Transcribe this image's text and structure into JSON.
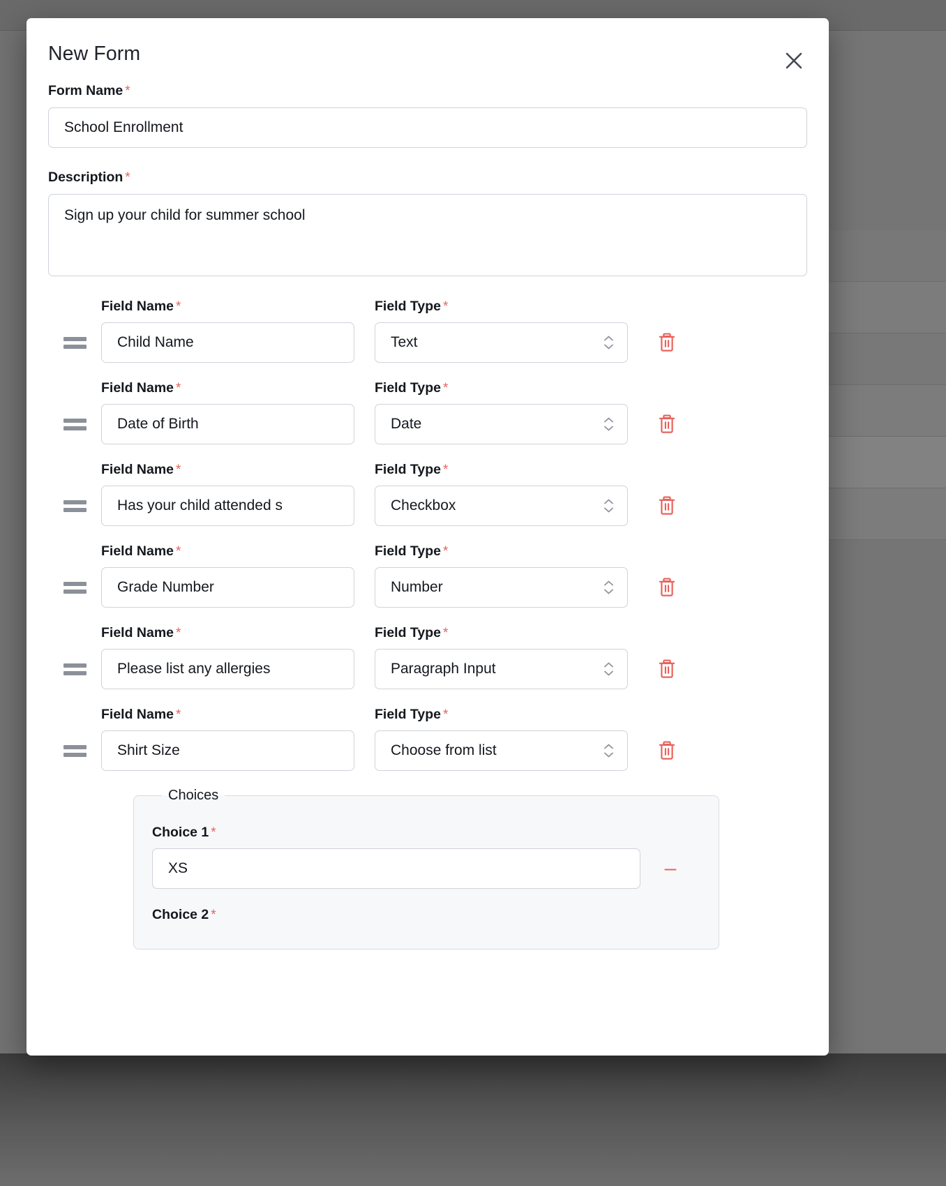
{
  "modal": {
    "title": "New Form",
    "close_icon": "close-icon",
    "form_name": {
      "label": "Form Name",
      "required_mark": "*",
      "value": "School Enrollment"
    },
    "description": {
      "label": "Description",
      "required_mark": "*",
      "value": "Sign up your child for summer school"
    },
    "column_labels": {
      "field_name": "Field Name",
      "field_type": "Field Type",
      "required_mark": "*"
    },
    "fields": [
      {
        "name": "Child Name",
        "type": "Text"
      },
      {
        "name": "Date of Birth",
        "type": "Date"
      },
      {
        "name": "Has your child attended s",
        "type": "Checkbox"
      },
      {
        "name": "Grade Number",
        "type": "Number"
      },
      {
        "name": "Please list any allergies",
        "type": "Paragraph Input"
      },
      {
        "name": "Shirt Size",
        "type": "Choose from list"
      }
    ],
    "choices": {
      "legend": "Choices",
      "items": [
        {
          "label": "Choice 1",
          "required_mark": "*",
          "value": "XS",
          "remove_label": "–"
        },
        {
          "label": "Choice 2",
          "required_mark": "*",
          "value": "",
          "remove_label": "–"
        }
      ]
    },
    "icons": {
      "drag_handle": "drag-handle-icon",
      "delete": "trash-icon",
      "stepper": "stepper-icon"
    }
  },
  "colors": {
    "required_red": "#e8625c",
    "trash_red": "#e8625c",
    "border": "#ced4da",
    "text": "#14181d",
    "handle_gray": "#8b9099",
    "choices_bg": "#f7f8fa"
  }
}
